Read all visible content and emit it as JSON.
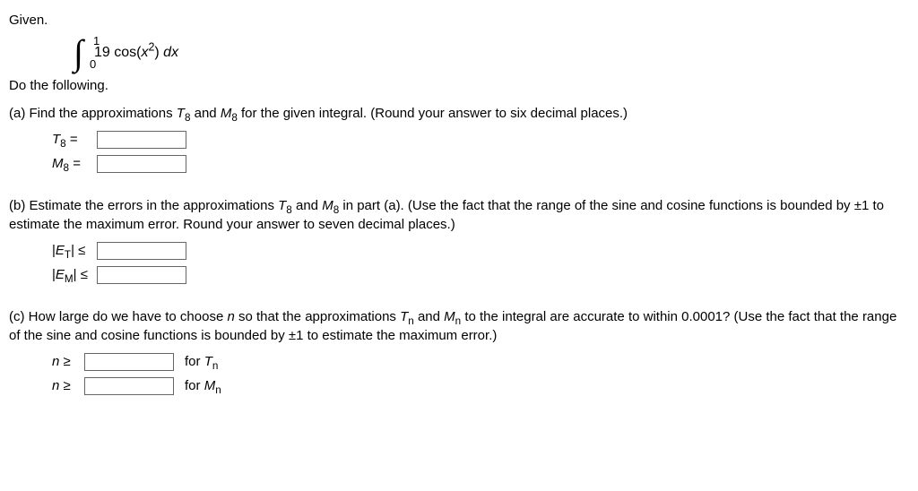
{
  "given_label": "Given.",
  "integral": {
    "upper": "1",
    "lower": "0",
    "coef": "19",
    "func_cos": "cos(",
    "x": "x",
    "sq": "2",
    "func_close": ")",
    "dx_d": "d",
    "dx_x": "x"
  },
  "do_following": "Do the following.",
  "part_a": {
    "text_before": "(a) Find the approximations ",
    "T8_T": "T",
    "T8_8": "8",
    "text_mid1": " and ",
    "M8_M": "M",
    "M8_8": "8",
    "text_after": " for the given integral. (Round your answer to six decimal places.)",
    "T8_label_T": "T",
    "T8_label_8": "8",
    "eq": "=",
    "M8_label_M": "M",
    "M8_label_8": "8"
  },
  "part_b": {
    "text_before": "(b) Estimate the errors in the approximations ",
    "T8_T": "T",
    "T8_8": "8",
    "text_mid1": " and ",
    "M8_M": "M",
    "M8_8": "8",
    "text_after": " in part (a). (Use the fact that the range of the sine and cosine functions is bounded by ±1 to estimate the maximum error. Round your answer to seven decimal places.)",
    "ET_open": "|",
    "ET_E": "E",
    "ET_T": "T",
    "ET_close": "|",
    "le": "≤",
    "EM_E": "E",
    "EM_M": "M"
  },
  "part_c": {
    "text_before": "(c) How large do we have to choose ",
    "n": "n",
    "text_mid1": " so that the approximations ",
    "Tn_T": "T",
    "Tn_n": "n",
    "text_mid2": " and ",
    "Mn_M": "M",
    "Mn_n": "n",
    "text_after": " to the integral are accurate to within 0.0001? (Use the fact that the range of the sine and cosine functions is bounded by ±1 to estimate the maximum error.)",
    "n_label_n": "n",
    "ge": "≥",
    "for": "for "
  }
}
